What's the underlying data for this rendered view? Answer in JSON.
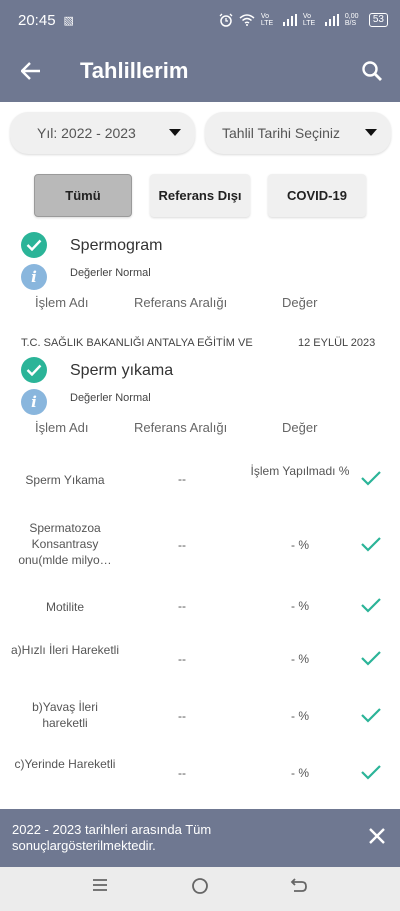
{
  "status_bar": {
    "time": "20:45",
    "network_label_1": "Vo LTE",
    "network_label_2": "Vo LTE",
    "data_speed": "0,00 B/S",
    "battery": "53"
  },
  "header": {
    "title": "Tahlillerim",
    "back_icon": "arrow-left-icon",
    "search_icon": "search-icon"
  },
  "filters": {
    "year_select": "Yıl: 2022 - 2023",
    "date_select": "Tahlil Tarihi Seçiniz",
    "buttons": [
      {
        "label": "Tümü",
        "active": true
      },
      {
        "label": "Referans Dışı",
        "active": false
      },
      {
        "label": "COVID-19",
        "active": false
      }
    ]
  },
  "columns": {
    "name": "İşlem Adı",
    "ref": "Referans Aralığı",
    "value": "Değer"
  },
  "tests": [
    {
      "title": "Spermogram",
      "status": "Değerler Normal"
    },
    {
      "institution": "T.C. SAĞLIK BAKANLIĞI ANTALYA EĞİTİM VE",
      "date": "12 EYLÜL 2023",
      "title": "Sperm yıkama",
      "status": "Değerler Normal"
    }
  ],
  "results": [
    {
      "name": "Sperm Yıkama",
      "ref": "--",
      "value": "İşlem Yapılmadı %"
    },
    {
      "name": "Spermatozoa Konsantrasy onu(mlde milyo…",
      "ref": "--",
      "value": "- %"
    },
    {
      "name": "Motilite",
      "ref": "--",
      "value": "- %"
    },
    {
      "name": "a)Hızlı İleri Hareketli",
      "ref": "--",
      "value": "- %"
    },
    {
      "name": "b)Yavaş İleri hareketli",
      "ref": "--",
      "value": "- %"
    },
    {
      "name": "c)Yerinde Hareketli",
      "ref": "--",
      "value": "- %"
    }
  ],
  "toast": {
    "message": "2022 - 2023 tarihleri arasında Tüm sonuçlargösterilmektedir."
  },
  "colors": {
    "header": "#6f7891",
    "check": "#2bb498",
    "info": "#89b6dd"
  }
}
